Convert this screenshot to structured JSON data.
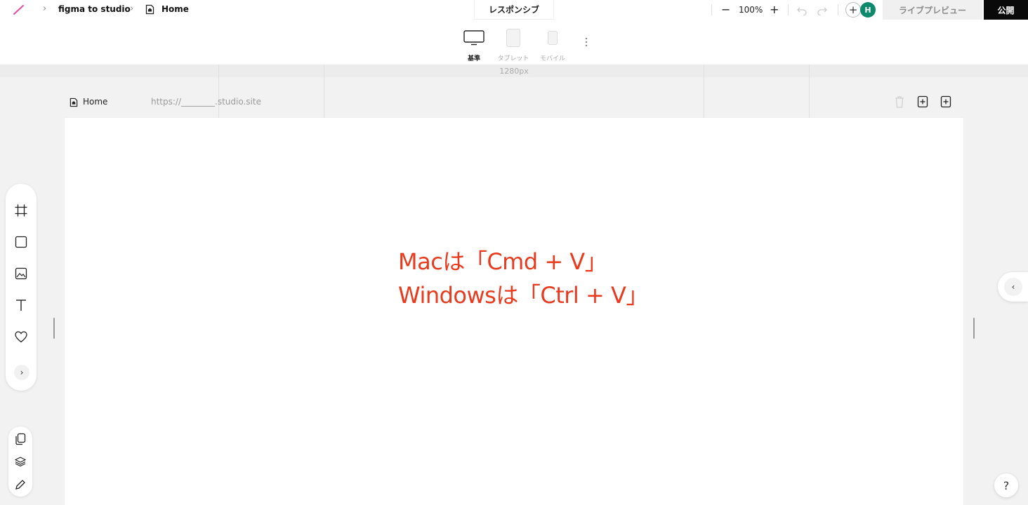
{
  "header": {
    "project_name": "figma to studio",
    "page_name": "Home",
    "center_tab": "レスポンシブ",
    "zoom_minus": "−",
    "zoom_level": "100%",
    "zoom_plus": "+",
    "add_label": "+",
    "avatar_initial": "H",
    "live_preview": "ライブプレビュー",
    "publish": "公開"
  },
  "devices": {
    "desktop": "基準",
    "tablet": "タブレット",
    "mobile": "モバイル",
    "width_readout": "1280px"
  },
  "page_bar": {
    "page_name": "Home",
    "url": "https://________.studio.site"
  },
  "canvas": {
    "line1": "Macは「Cmd + V」",
    "line2": "Windowsは「Ctrl + V」"
  },
  "left_toolbar": {
    "expand": "›"
  },
  "right_panel": {
    "toggle": "‹"
  },
  "help": {
    "label": "?"
  },
  "colors": {
    "annotation_red": "#ea3a1e",
    "avatar_green": "#0d8a6c",
    "publish_black": "#0a0a0a"
  }
}
